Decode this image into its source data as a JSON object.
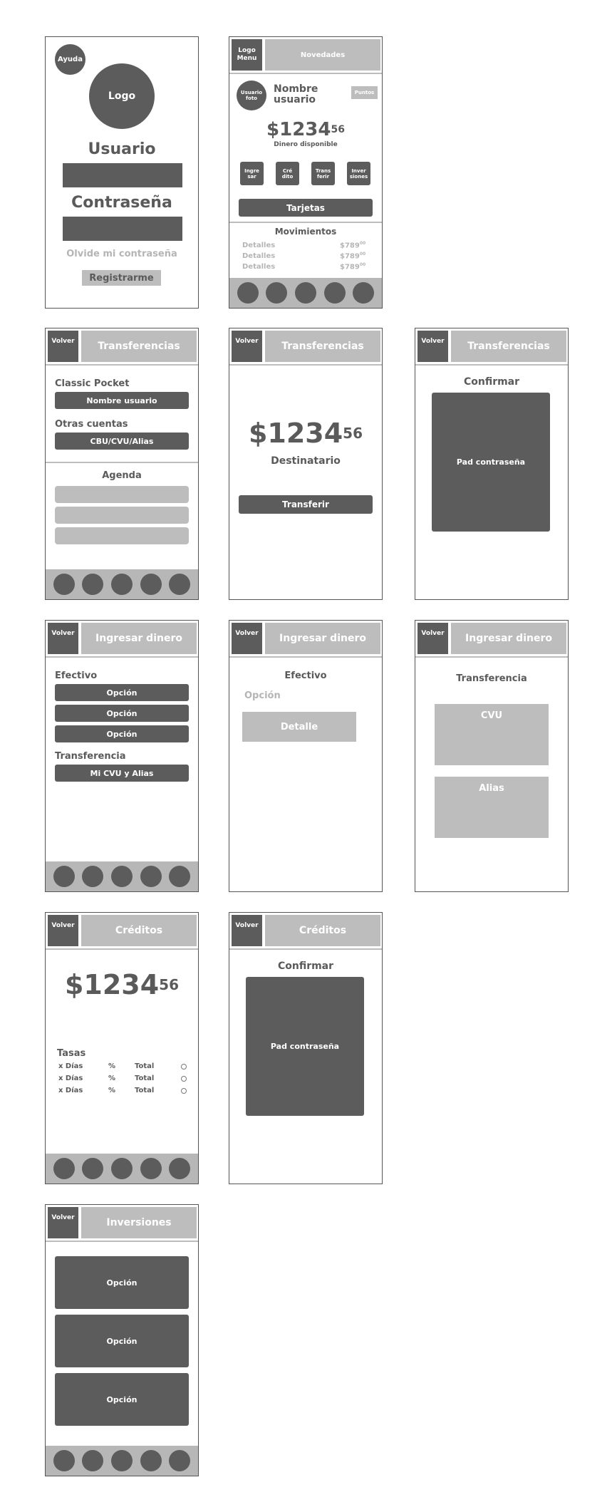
{
  "login": {
    "help": "Ayuda",
    "logo": "Logo",
    "user_label": "Usuario",
    "password_label": "Contraseña",
    "forgot": "Olvide mi contraseña",
    "register": "Registrarme"
  },
  "home": {
    "logo_menu": "Logo\nMenu",
    "news": "Novedades",
    "user_photo": "Usuario\nfoto",
    "user_name": "Nombre\nusuario",
    "points": "Puntos",
    "amount": "$1234",
    "cents": "56",
    "available": "Dinero disponible",
    "actions": [
      "Ingre\nsar",
      "Cré\ndito",
      "Trans\nferir",
      "Inver\nsiones"
    ],
    "cards": "Tarjetas",
    "movements_title": "Movimientos",
    "movements": [
      {
        "label": "Detalles",
        "amount": "$789",
        "cents": "00"
      },
      {
        "label": "Detalles",
        "amount": "$789",
        "cents": "00"
      },
      {
        "label": "Detalles",
        "amount": "$789",
        "cents": "00"
      }
    ]
  },
  "common": {
    "back": "Volver",
    "pad": "Pad contraseña",
    "confirm": "Confirmar",
    "option": "Opción",
    "amount": "$1234",
    "cents": "56"
  },
  "transfers": {
    "title": "Transferencias",
    "classic": "Classic Pocket",
    "username": "Nombre usuario",
    "other": "Otras cuentas",
    "cbu": "CBU/CVU/Alias",
    "agenda": "Agenda",
    "recipient": "Destinatario",
    "transfer_btn": "Transferir"
  },
  "deposit": {
    "title": "Ingresar dinero",
    "cash": "Efectivo",
    "transfer": "Transferencia",
    "my_cvu": "Mi CVU y Alias",
    "detail": "Detalle",
    "cvu": "CVU",
    "alias": "Alias"
  },
  "credits": {
    "title": "Créditos",
    "rates": "Tasas",
    "rows": [
      {
        "days": "x Días",
        "pct": "%",
        "total": "Total"
      },
      {
        "days": "x Días",
        "pct": "%",
        "total": "Total"
      },
      {
        "days": "x Días",
        "pct": "%",
        "total": "Total"
      }
    ]
  },
  "investments": {
    "title": "Inversiones"
  }
}
